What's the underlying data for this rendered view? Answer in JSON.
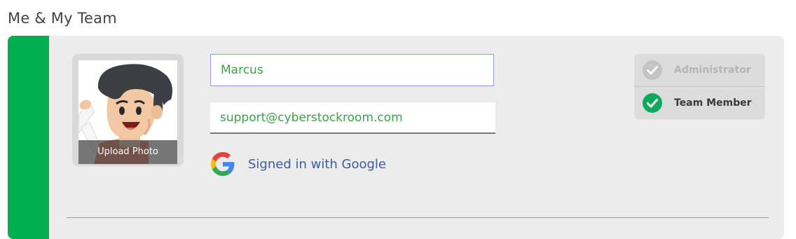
{
  "section": {
    "title": "Me & My Team"
  },
  "profile": {
    "photo_overlay_label": "Upload Photo",
    "name_value": "Marcus",
    "email_value": "support@cyberstockroom.com",
    "signin_label": "Signed in with Google"
  },
  "roles": {
    "items": [
      {
        "label": "Administrator",
        "selected": false
      },
      {
        "label": "Team Member",
        "selected": true
      }
    ]
  },
  "colors": {
    "accent": "#00b050",
    "check_selected": "#10a95b",
    "check_unselected": "#c4c4c4",
    "input_text": "#3fa24a",
    "link_text": "#3a5d9f"
  },
  "icons": {
    "google": "google-logo-icon",
    "check": "check-circle-icon"
  }
}
